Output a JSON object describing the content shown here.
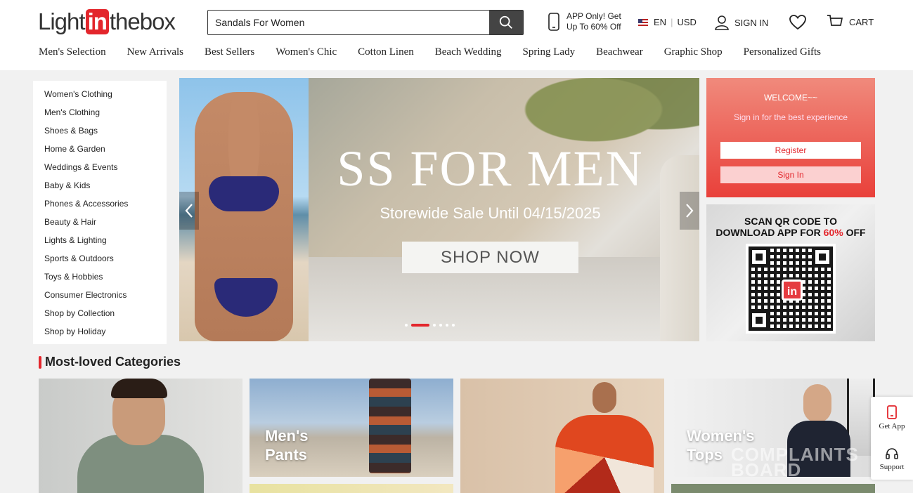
{
  "header": {
    "logo": {
      "pre": "Light",
      "in": "in",
      "post": "thebox"
    },
    "search": {
      "value": "Sandals For Women",
      "placeholder": "Sandals For Women"
    },
    "app_promo": {
      "line1": "APP Only! Get",
      "line2": "Up To 60% Off"
    },
    "language": "EN",
    "currency": "USD",
    "sign_in": "SIGN IN",
    "cart": "CART"
  },
  "nav": [
    "Men's Selection",
    "New Arrivals",
    "Best Sellers",
    "Women's Chic",
    "Cotton Linen",
    "Beach Wedding",
    "Spring Lady",
    "Beachwear",
    "Graphic Shop",
    "Personalized Gifts"
  ],
  "sidebar": [
    "Women's Clothing",
    "Men's Clothing",
    "Shoes & Bags",
    "Home & Garden",
    "Weddings & Events",
    "Baby & Kids",
    "Phones & Accessories",
    "Beauty & Hair",
    "Lights & Lighting",
    "Sports & Outdoors",
    "Toys & Hobbies",
    "Consumer Electronics",
    "Shop by Collection",
    "Shop by Holiday"
  ],
  "banner": {
    "title": "SS FOR MEN",
    "subtitle": "Storewide Sale Until 04/15/2025",
    "button": "SHOP NOW",
    "slide_count": 6,
    "active_slide": 2
  },
  "welcome": {
    "title": "WELCOME~~",
    "subtitle": "Sign in for the best experience",
    "register": "Register",
    "sign_in": "Sign In"
  },
  "qr_promo": {
    "line1": "SCAN QR CODE TO",
    "line2_prefix": "DOWNLOAD APP FOR ",
    "line2_highlight": "60%",
    "line2_suffix": " OFF",
    "logo": "in"
  },
  "most_loved": {
    "title": "Most-loved Categories",
    "tiles": [
      {
        "caption1": "Men's",
        "caption2": "Pants"
      },
      {
        "caption1": "Women's",
        "caption2": "Tops"
      }
    ]
  },
  "watermark": {
    "line1": "COMPLAINTS",
    "line2": "BOARD"
  },
  "floating": {
    "get_app": "Get App",
    "support": "Support"
  },
  "colors": {
    "brand_red": "#e3262c",
    "search_button": "#444444"
  }
}
